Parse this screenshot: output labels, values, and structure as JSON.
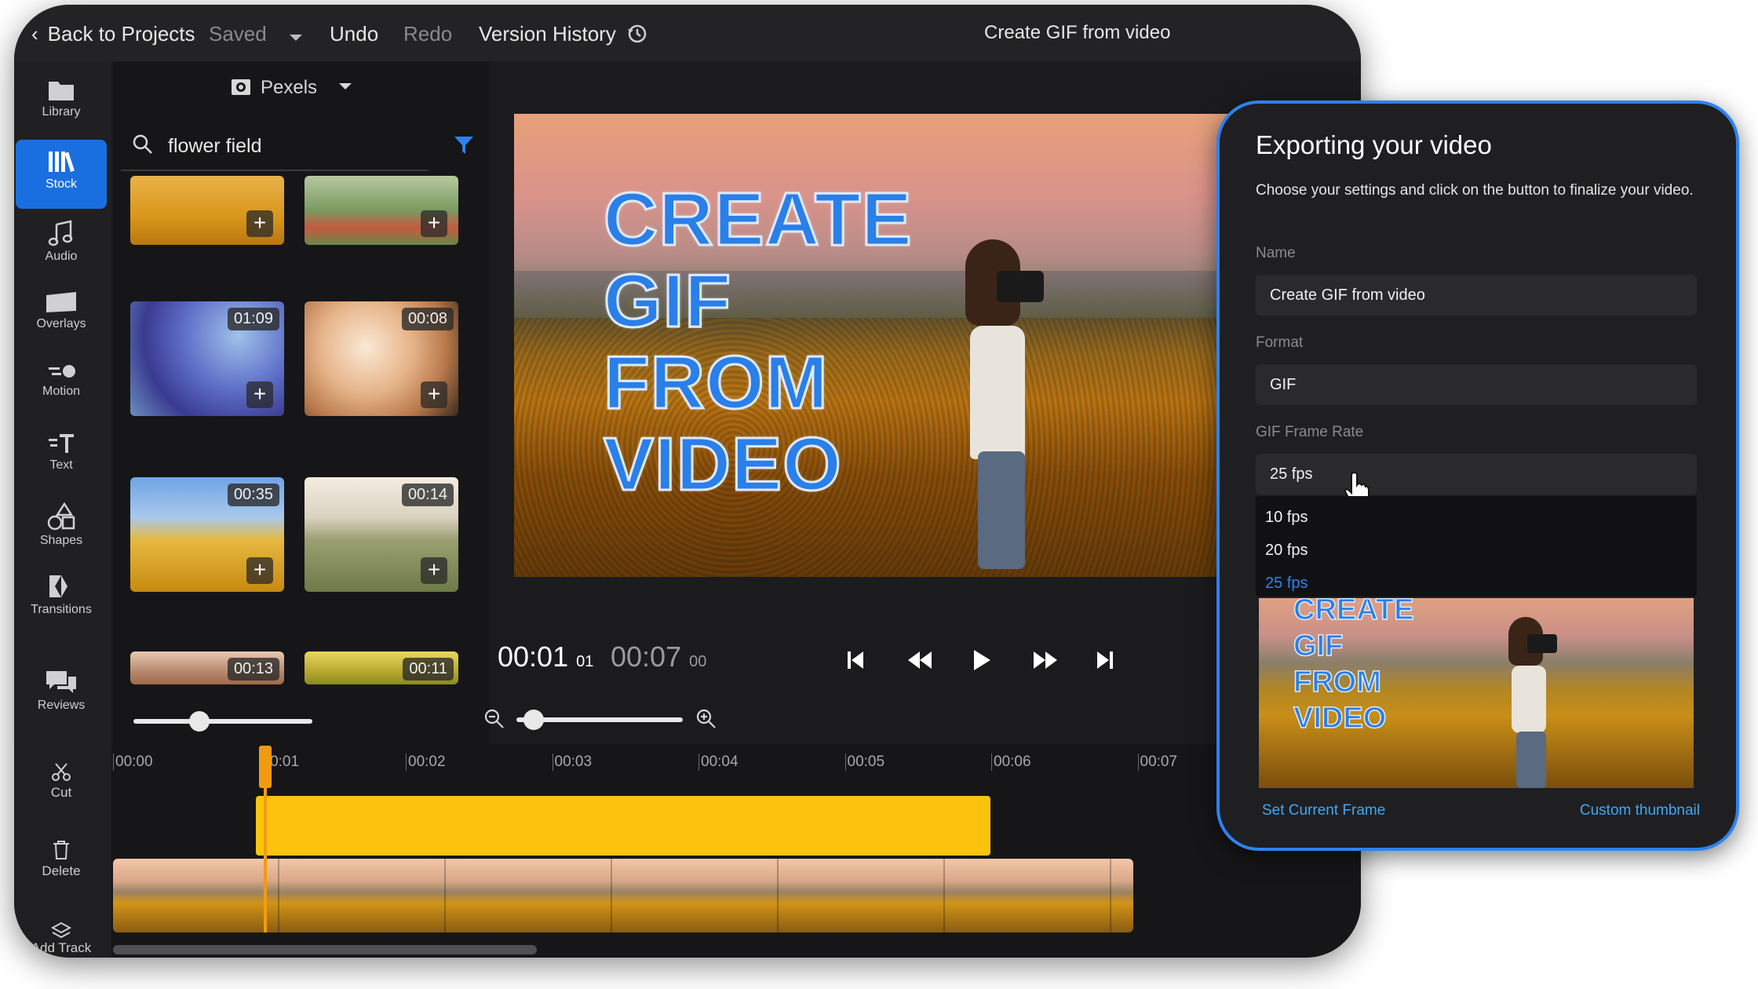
{
  "topbar": {
    "back": "Back to Projects",
    "saved": "Saved",
    "undo": "Undo",
    "redo": "Redo",
    "version_history": "Version History",
    "project_title": "Create GIF from video"
  },
  "sidebar": {
    "items": [
      {
        "label": "Library",
        "icon": "folder-icon"
      },
      {
        "label": "Stock",
        "icon": "books-icon",
        "active": true
      },
      {
        "label": "Audio",
        "icon": "music-note-icon"
      },
      {
        "label": "Overlays",
        "icon": "overlay-icon"
      },
      {
        "label": "Motion",
        "icon": "motion-icon"
      },
      {
        "label": "Text",
        "icon": "text-icon"
      },
      {
        "label": "Shapes",
        "icon": "shapes-icon"
      },
      {
        "label": "Transitions",
        "icon": "transitions-icon"
      },
      {
        "label": "Reviews",
        "icon": "chat-bubbles-icon"
      }
    ]
  },
  "stock": {
    "source": "Pexels",
    "search_value": "flower field",
    "thumbs": [
      {
        "duration": ""
      },
      {
        "duration": ""
      },
      {
        "duration": "01:09"
      },
      {
        "duration": "00:08"
      },
      {
        "duration": "00:35"
      },
      {
        "duration": "00:14"
      },
      {
        "duration": "00:13"
      },
      {
        "duration": "00:11"
      }
    ],
    "zoom_level": 0.35
  },
  "preview": {
    "lines": [
      "CREATE",
      "GIF",
      "FROM",
      "VIDEO"
    ]
  },
  "playback": {
    "current_main": "00:01",
    "current_frames": "01",
    "total_main": "00:07",
    "total_frames": "00",
    "zoom_level": 0.05
  },
  "timeline": {
    "tools": {
      "cut": "Cut",
      "delete": "Delete",
      "add_track": "Add Track"
    },
    "ticks": [
      "00:00",
      "00:01",
      "00:02",
      "00:03",
      "00:04",
      "00:05",
      "00:06",
      "00:07"
    ],
    "playhead": "00:01"
  },
  "export": {
    "title": "Exporting your video",
    "description": "Choose your settings and click on the button to finalize your video.",
    "name_label": "Name",
    "name_value": "Create GIF from video",
    "format_label": "Format",
    "format_value": "GIF",
    "fps_label": "GIF Frame Rate",
    "fps_value": "25 fps",
    "fps_options": [
      "10 fps",
      "20 fps",
      "25 fps"
    ],
    "thumb_lines": [
      "CREATE",
      "GIF",
      "FROM",
      "VIDEO"
    ],
    "set_current_frame": "Set Current Frame",
    "custom_thumbnail": "Custom thumbnail",
    "accent": "#2c83f0"
  }
}
